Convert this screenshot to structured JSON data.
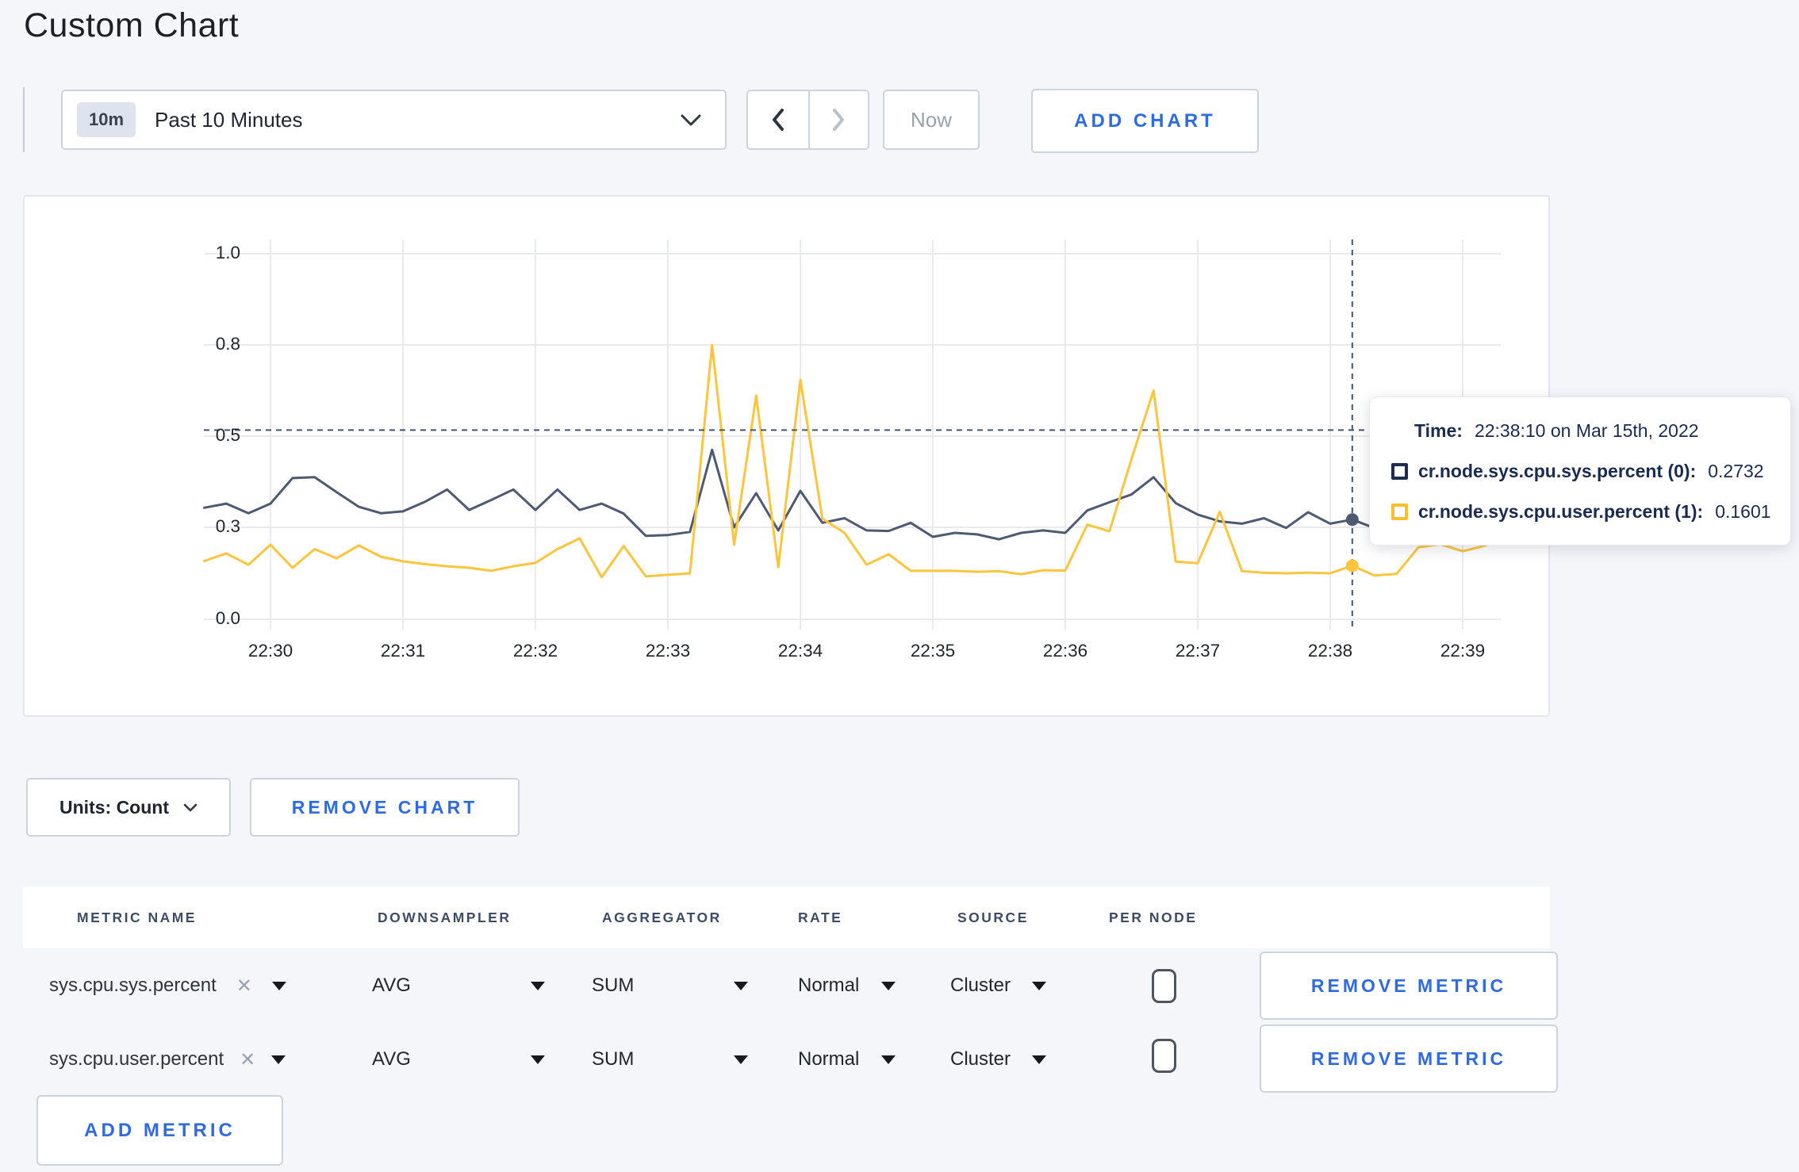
{
  "title": "Custom Chart",
  "controls": {
    "timescale": {
      "badge": "10m",
      "label": "Past 10 Minutes"
    },
    "now_label": "Now",
    "add_chart_label": "ADD CHART"
  },
  "colors": {
    "accent_blue": "#2e6be2",
    "crosshair": "#45556f",
    "grid": "#e8eaee"
  },
  "chart_data": {
    "type": "line",
    "title": "",
    "xlabel": "",
    "ylabel": "",
    "units": "Count",
    "x_tick_labels": [
      "22:30",
      "22:31",
      "22:32",
      "22:33",
      "22:34",
      "22:35",
      "22:36",
      "22:37",
      "22:38",
      "22:39"
    ],
    "y_tick_labels": [
      "0.0",
      "0.3",
      "0.5",
      "0.8",
      "1.0"
    ],
    "y_tick_values": [
      0.0,
      0.3,
      0.5,
      0.8,
      1.0
    ],
    "ylim": [
      0.0,
      1.0
    ],
    "grid": true,
    "start_time": "22:29:30",
    "interval_seconds": 10,
    "series": [
      {
        "name": "cr.node.sys.cpu.sys.percent",
        "color": "#4e5a73",
        "values": [
          0.343,
          0.352,
          0.331,
          0.352,
          0.408,
          0.41,
          0.377,
          0.345,
          0.331,
          0.335,
          0.356,
          0.383,
          0.338,
          0.36,
          0.383,
          0.338,
          0.383,
          0.338,
          0.352,
          0.33,
          0.272,
          0.275,
          0.285,
          0.47,
          0.3,
          0.375,
          0.29,
          0.38,
          0.31,
          0.32,
          0.29,
          0.288,
          0.31,
          0.269,
          0.282,
          0.277,
          0.261,
          0.282,
          0.29,
          0.282,
          0.337,
          0.355,
          0.372,
          0.41,
          0.353,
          0.328,
          0.313,
          0.308,
          0.32,
          0.298,
          0.333,
          0.308,
          0.317,
          0.298,
          0.291,
          0.298,
          0.308,
          0.298,
          0.311,
          0.308
        ]
      },
      {
        "name": "cr.node.sys.cpu.user.percent",
        "color": "#fcc53d",
        "values": [
          0.19,
          0.215,
          0.178,
          0.243,
          0.168,
          0.229,
          0.199,
          0.241,
          0.204,
          0.189,
          0.18,
          0.173,
          0.168,
          0.158,
          0.173,
          0.184,
          0.229,
          0.264,
          0.137,
          0.239,
          0.14,
          0.145,
          0.15,
          0.8,
          0.243,
          0.633,
          0.17,
          0.685,
          0.319,
          0.282,
          0.178,
          0.212,
          0.158,
          0.158,
          0.158,
          0.155,
          0.157,
          0.147,
          0.16,
          0.159,
          0.306,
          0.287,
          0.45,
          0.65,
          0.188,
          0.183,
          0.334,
          0.157,
          0.152,
          0.15,
          0.152,
          0.15,
          0.175,
          0.143,
          0.148,
          0.235,
          0.245,
          0.222,
          0.24,
          0.274
        ]
      }
    ],
    "crosshair": {
      "index": 52,
      "time": "22:38:10",
      "y_value": 0.52
    },
    "legend_position": "tooltip"
  },
  "tooltip": {
    "time_label": "Time:",
    "time_value": "22:38:10 on Mar 15th, 2022",
    "series": [
      {
        "label": "cr.node.sys.cpu.sys.percent (0):",
        "value": "0.2732",
        "swatch_color": "#1b2b52"
      },
      {
        "label": "cr.node.sys.cpu.user.percent (1):",
        "value": "0.1601",
        "swatch_color": "#fdbe2c"
      }
    ]
  },
  "units": {
    "label": "Units: Count",
    "remove_chart_label": "REMOVE CHART"
  },
  "table": {
    "headers": [
      "METRIC NAME",
      "DOWNSAMPLER",
      "AGGREGATOR",
      "RATE",
      "SOURCE",
      "PER NODE"
    ],
    "rows": [
      {
        "metric": "sys.cpu.sys.percent",
        "downsampler": "AVG",
        "aggregator": "SUM",
        "rate": "Normal",
        "source": "Cluster",
        "per_node_checked": false,
        "remove_label": "REMOVE METRIC"
      },
      {
        "metric": "sys.cpu.user.percent",
        "downsampler": "AVG",
        "aggregator": "SUM",
        "rate": "Normal",
        "source": "Cluster",
        "per_node_checked": false,
        "remove_label": "REMOVE METRIC"
      }
    ],
    "add_metric_label": "ADD METRIC"
  }
}
